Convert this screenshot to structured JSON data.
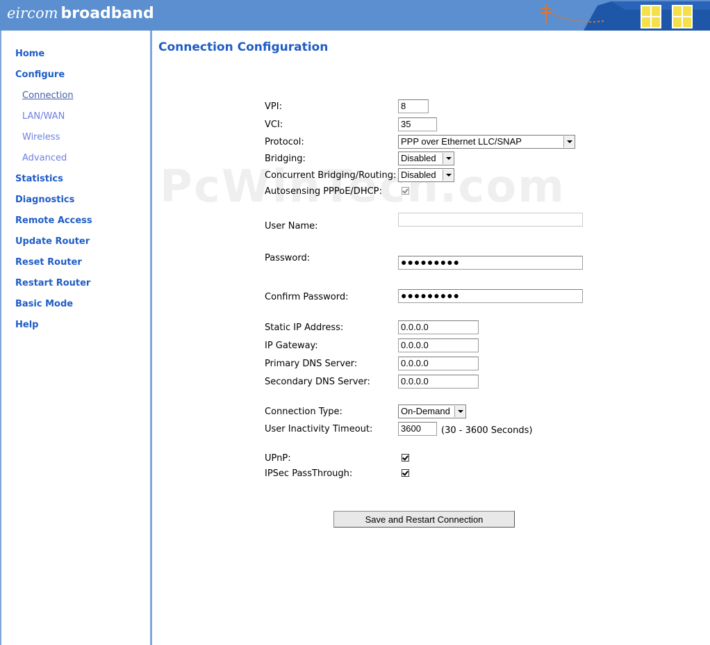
{
  "header": {
    "brand_light": "eircom",
    "brand_bold": "broadband"
  },
  "sidebar": {
    "items": [
      {
        "label": "Home"
      },
      {
        "label": "Configure"
      },
      {
        "label": "Connection"
      },
      {
        "label": "LAN/WAN"
      },
      {
        "label": "Wireless"
      },
      {
        "label": "Advanced"
      },
      {
        "label": "Statistics"
      },
      {
        "label": "Diagnostics"
      },
      {
        "label": "Remote Access"
      },
      {
        "label": "Update Router"
      },
      {
        "label": "Reset Router"
      },
      {
        "label": "Restart Router"
      },
      {
        "label": "Basic Mode"
      },
      {
        "label": "Help"
      }
    ]
  },
  "main": {
    "title": "Connection Configuration",
    "watermark": "PcWinTech.com"
  },
  "form": {
    "vpi": {
      "label": "VPI:",
      "value": "8"
    },
    "vci": {
      "label": "VCI:",
      "value": "35"
    },
    "protocol": {
      "label": "Protocol:",
      "value": "PPP over Ethernet LLC/SNAP"
    },
    "bridging": {
      "label": "Bridging:",
      "value": "Disabled"
    },
    "concurrent": {
      "label": "Concurrent Bridging/Routing:",
      "value": "Disabled"
    },
    "autosensing": {
      "label": "Autosensing PPPoE/DHCP:",
      "checked": true
    },
    "username": {
      "label": "User Name:",
      "value": ""
    },
    "password": {
      "label": "Password:",
      "value": "●●●●●●●●●"
    },
    "confirm_password": {
      "label": "Confirm Password:",
      "value": "●●●●●●●●●"
    },
    "static_ip": {
      "label": "Static IP Address:",
      "value": "0.0.0.0"
    },
    "gateway": {
      "label": "IP Gateway:",
      "value": "0.0.0.0"
    },
    "primary_dns": {
      "label": "Primary DNS Server:",
      "value": "0.0.0.0"
    },
    "secondary_dns": {
      "label": "Secondary DNS Server:",
      "value": "0.0.0.0"
    },
    "connection_type": {
      "label": "Connection Type:",
      "value": "On-Demand"
    },
    "inactivity": {
      "label": "User Inactivity Timeout:",
      "value": "3600",
      "hint": "(30 - 3600 Seconds)"
    },
    "upnp": {
      "label": "UPnP:",
      "checked": true
    },
    "ipsec": {
      "label": "IPSec PassThrough:",
      "checked": true
    },
    "save_label": "Save and Restart Connection"
  },
  "colors": {
    "header_bg": "#5b8fcf",
    "link": "#1f5cc7",
    "sublink": "#6c7fe0"
  }
}
